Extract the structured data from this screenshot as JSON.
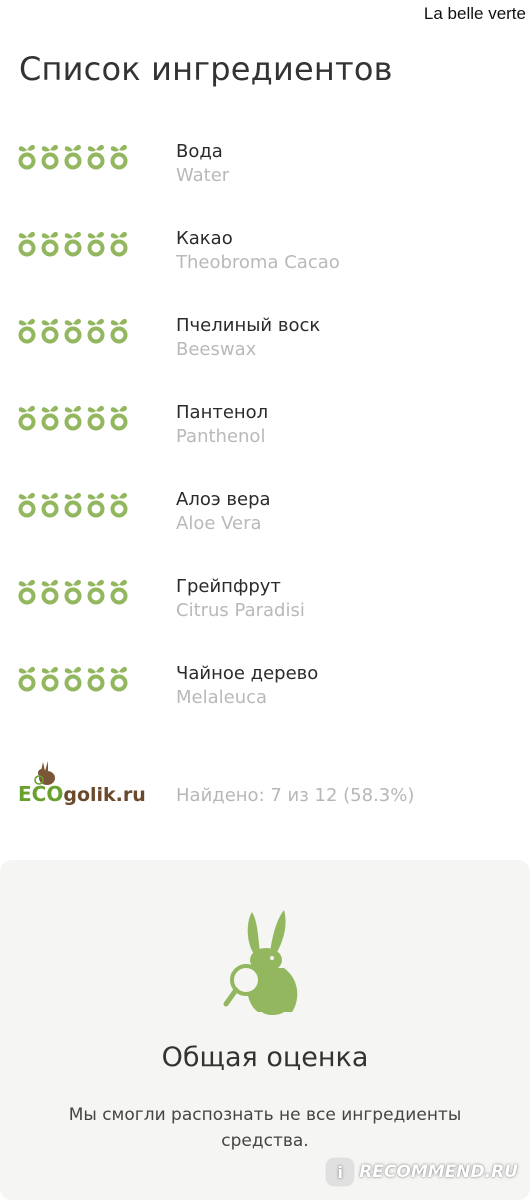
{
  "brand": "La belle verte",
  "title": "Список ингредиентов",
  "ingredients": [
    {
      "ru": "Вода",
      "lat": "Water",
      "rating": 5
    },
    {
      "ru": "Какао",
      "lat": "Theobroma Cacao",
      "rating": 5
    },
    {
      "ru": "Пчелиный воск",
      "lat": "Beeswax",
      "rating": 5
    },
    {
      "ru": "Пантенол",
      "lat": "Panthenol",
      "rating": 5
    },
    {
      "ru": "Алоэ вера",
      "lat": "Aloe Vera",
      "rating": 5
    },
    {
      "ru": "Грейпфрут",
      "lat": "Citrus Paradisi",
      "rating": 5
    },
    {
      "ru": "Чайное дерево",
      "lat": "Melaleuca",
      "rating": 5
    }
  ],
  "source": {
    "logo_prefix": "ECO",
    "logo_suffix": "golik.ru",
    "found_text": "Найдено: 7 из 12 (58.3%)"
  },
  "summary": {
    "title": "Общая оценка",
    "text": "Мы смогли распознать не все ингредиенты средства.",
    "icon": "rabbit-magnifier-icon"
  },
  "watermark": {
    "label": "RECOMMEND.RU",
    "icon": "i-icon"
  },
  "colors": {
    "leaf": "#93b75f",
    "eco_green": "#6aa12d",
    "eco_brown": "#6a4a2c",
    "card_bg": "#f5f5f3"
  }
}
